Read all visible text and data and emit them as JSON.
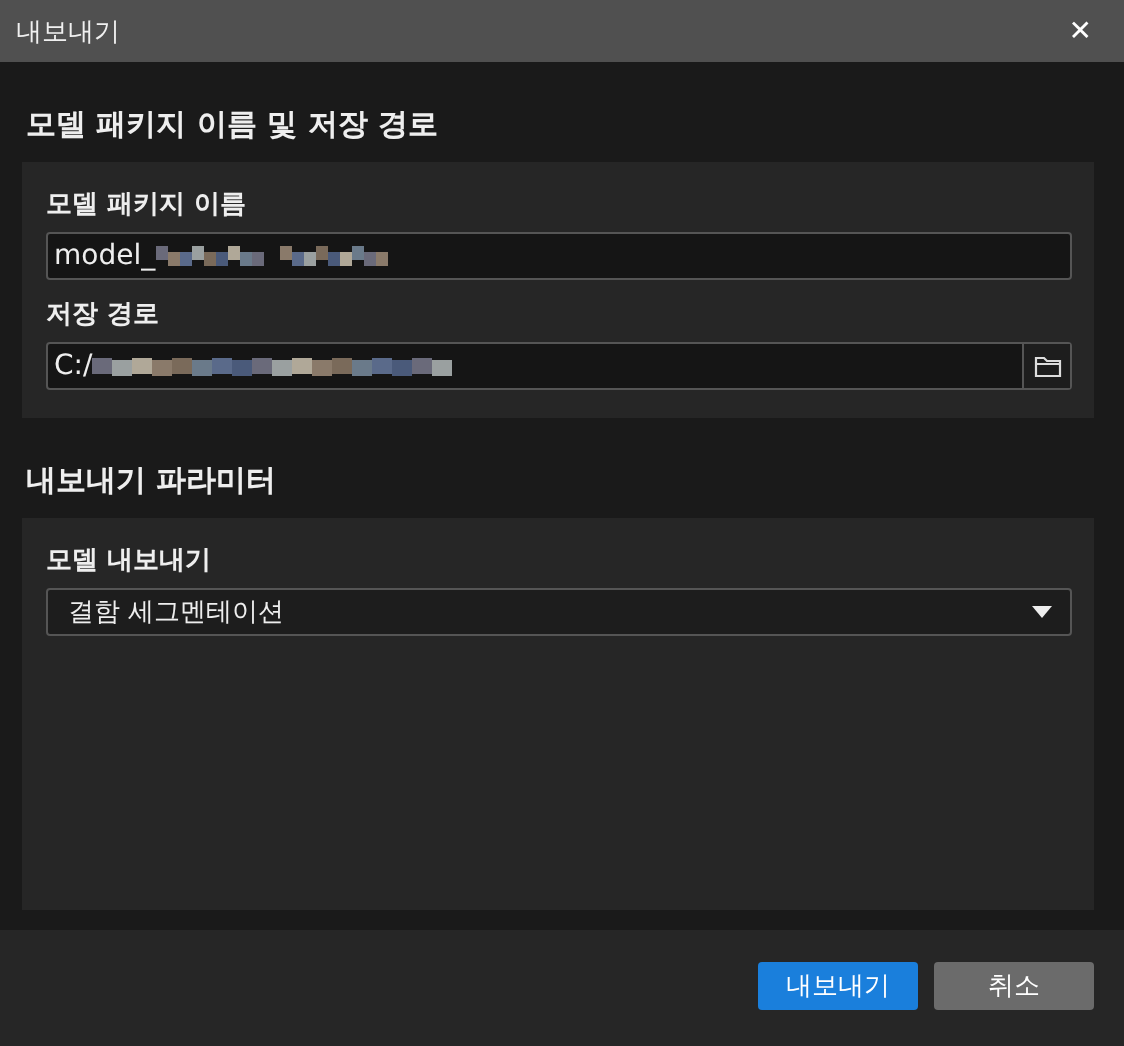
{
  "window": {
    "title": "내보내기",
    "close": "✕"
  },
  "sections": [
    {
      "title": "모델 패키지 이름 및 저장 경로",
      "fields": [
        {
          "kind": "text",
          "label": "모델 패키지 이름",
          "value": "model_"
        },
        {
          "kind": "path",
          "label": "저장 경로",
          "value": "C:/"
        }
      ]
    },
    {
      "title": "내보내기 파라미터",
      "fields": [
        {
          "kind": "select",
          "label": "모델 내보내기",
          "value": "결함 세그멘테이션"
        }
      ]
    }
  ],
  "buttons": [
    {
      "label": "내보내기",
      "kind": "primary"
    },
    {
      "label": "취소",
      "kind": "secondary"
    }
  ]
}
